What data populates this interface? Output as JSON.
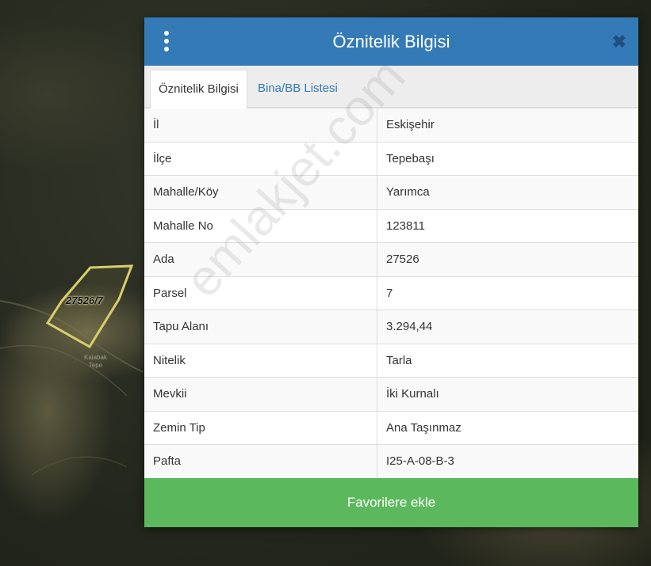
{
  "map": {
    "parcel_label": "27526/7",
    "place_label_line1": "Kalabak",
    "place_label_line2": "Tepe",
    "watermark": "emlakjet.com"
  },
  "dialog": {
    "title": "Öznitelik Bilgisi",
    "menu_icon": "vertical-dots-icon",
    "close_label": "✖",
    "tabs": [
      {
        "label": "Öznitelik Bilgisi",
        "active": true
      },
      {
        "label": "Bina/BB Listesi",
        "active": false
      }
    ],
    "rows": [
      {
        "key": "İl",
        "value": "Eskişehir"
      },
      {
        "key": "İlçe",
        "value": "Tepebaşı"
      },
      {
        "key": "Mahalle/Köy",
        "value": "Yarımca"
      },
      {
        "key": "Mahalle No",
        "value": "123811"
      },
      {
        "key": "Ada",
        "value": "27526"
      },
      {
        "key": "Parsel",
        "value": "7"
      },
      {
        "key": "Tapu Alanı",
        "value": "3.294,44"
      },
      {
        "key": "Nitelik",
        "value": "Tarla"
      },
      {
        "key": "Mevkii",
        "value": "İki Kurnalı"
      },
      {
        "key": "Zemin Tip",
        "value": "Ana Taşınmaz"
      },
      {
        "key": "Pafta",
        "value": "I25-A-08-B-3"
      }
    ],
    "favorite_button_label": "Favorilere ekle"
  },
  "colors": {
    "header": "#337ab7",
    "button": "#5cb85c",
    "parcel_outline": "#d8cf6a"
  }
}
